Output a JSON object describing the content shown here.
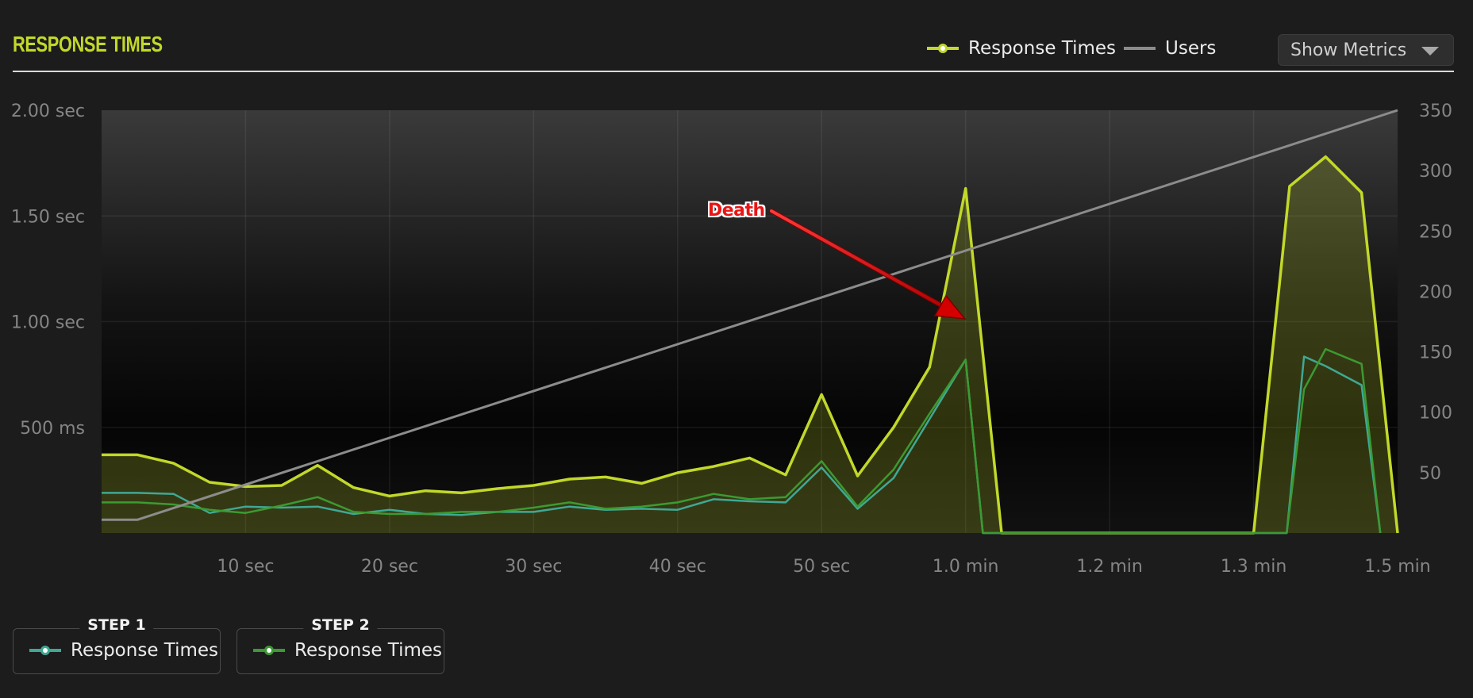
{
  "header": {
    "title": "RESPONSE TIMES",
    "legend": [
      {
        "label": "Response Times",
        "color": "#c2d82a",
        "marker": "circle-line"
      },
      {
        "label": "Users",
        "color": "#8c8c8c",
        "marker": "line"
      }
    ],
    "show_metrics_label": "Show Metrics"
  },
  "annotation": {
    "label": "Death",
    "color": "#e81515"
  },
  "steps": [
    {
      "title": "STEP 1",
      "label": "Response Times",
      "color": "#3fa894"
    },
    {
      "title": "STEP 2",
      "label": "Response Times",
      "color": "#3c9a32"
    }
  ],
  "chart_data": {
    "type": "area",
    "x_unit": "sec",
    "xlim": [
      0,
      90
    ],
    "xticks": [
      {
        "v": 10,
        "label": "10 sec"
      },
      {
        "v": 20,
        "label": "20 sec"
      },
      {
        "v": 30,
        "label": "30 sec"
      },
      {
        "v": 40,
        "label": "40 sec"
      },
      {
        "v": 50,
        "label": "50 sec"
      },
      {
        "v": 60,
        "label": "1.0 min"
      },
      {
        "v": 70,
        "label": "1.2 min"
      },
      {
        "v": 80,
        "label": "1.3 min"
      },
      {
        "v": 90,
        "label": "1.5 min"
      }
    ],
    "y_left": {
      "unit": "ms",
      "ylim": [
        0,
        2000
      ],
      "ticks": [
        {
          "v": 2000,
          "label": "2.00 sec"
        },
        {
          "v": 1500,
          "label": "1.50 sec"
        },
        {
          "v": 1000,
          "label": "1.00 sec"
        },
        {
          "v": 500,
          "label": "500 ms"
        }
      ]
    },
    "y_right": {
      "unit": "users",
      "ylim": [
        0,
        350
      ],
      "ticks": [
        50,
        100,
        150,
        200,
        250,
        300,
        350
      ]
    },
    "grid": true,
    "legend_position": "top-right",
    "series": [
      {
        "name": "Response Times",
        "axis": "left",
        "color": "#c2d82a",
        "fill": true,
        "x": [
          0,
          2.5,
          5,
          7.5,
          10,
          12.5,
          15,
          17.5,
          20,
          22.5,
          25,
          27.5,
          30,
          32.5,
          35,
          37.5,
          40,
          42.5,
          45,
          47.5,
          50,
          52.5,
          55,
          57.5,
          60,
          62.5,
          65,
          67.5,
          70,
          72.5,
          75,
          77.5,
          80,
          82.5,
          85,
          87.5,
          90
        ],
        "y": [
          370,
          370,
          330,
          240,
          220,
          225,
          320,
          215,
          175,
          200,
          190,
          210,
          225,
          255,
          265,
          235,
          285,
          315,
          355,
          275,
          655,
          270,
          500,
          785,
          1630,
          0,
          0,
          0,
          0,
          0,
          0,
          0,
          0,
          1640,
          1780,
          1610,
          0
        ]
      },
      {
        "name": "Step 1 Response Times",
        "axis": "left",
        "color": "#3fa894",
        "fill": false,
        "x": [
          0,
          2.5,
          5,
          7.5,
          10,
          12.5,
          15,
          17.5,
          20,
          22.5,
          25,
          27.5,
          30,
          32.5,
          35,
          37.5,
          40,
          42.5,
          45,
          47.5,
          50,
          52.5,
          55,
          57.5,
          60,
          61.2,
          82.3,
          83.5,
          85,
          87.5,
          88.8
        ],
        "y": [
          190,
          190,
          185,
          95,
          125,
          120,
          125,
          90,
          110,
          90,
          85,
          100,
          100,
          125,
          110,
          115,
          110,
          160,
          150,
          145,
          310,
          115,
          260,
          540,
          820,
          0,
          0,
          835,
          790,
          700,
          0
        ]
      },
      {
        "name": "Step 2 Response Times",
        "axis": "left",
        "color": "#3c9a32",
        "fill": false,
        "x": [
          0,
          2.5,
          5,
          7.5,
          10,
          12.5,
          15,
          17.5,
          20,
          22.5,
          25,
          27.5,
          30,
          32.5,
          35,
          37.5,
          40,
          42.5,
          45,
          47.5,
          50,
          52.5,
          55,
          57.5,
          60,
          61.2,
          82.3,
          83.5,
          85,
          87.5,
          88.8
        ],
        "y": [
          145,
          145,
          135,
          110,
          95,
          130,
          170,
          100,
          90,
          90,
          100,
          100,
          120,
          145,
          115,
          125,
          145,
          185,
          160,
          170,
          340,
          125,
          300,
          565,
          820,
          0,
          0,
          680,
          870,
          800,
          0
        ]
      },
      {
        "name": "Users",
        "axis": "right",
        "color": "#8c8c8c",
        "fill": false,
        "x": [
          0,
          2.5,
          90
        ],
        "y": [
          11,
          11,
          350
        ]
      }
    ]
  }
}
